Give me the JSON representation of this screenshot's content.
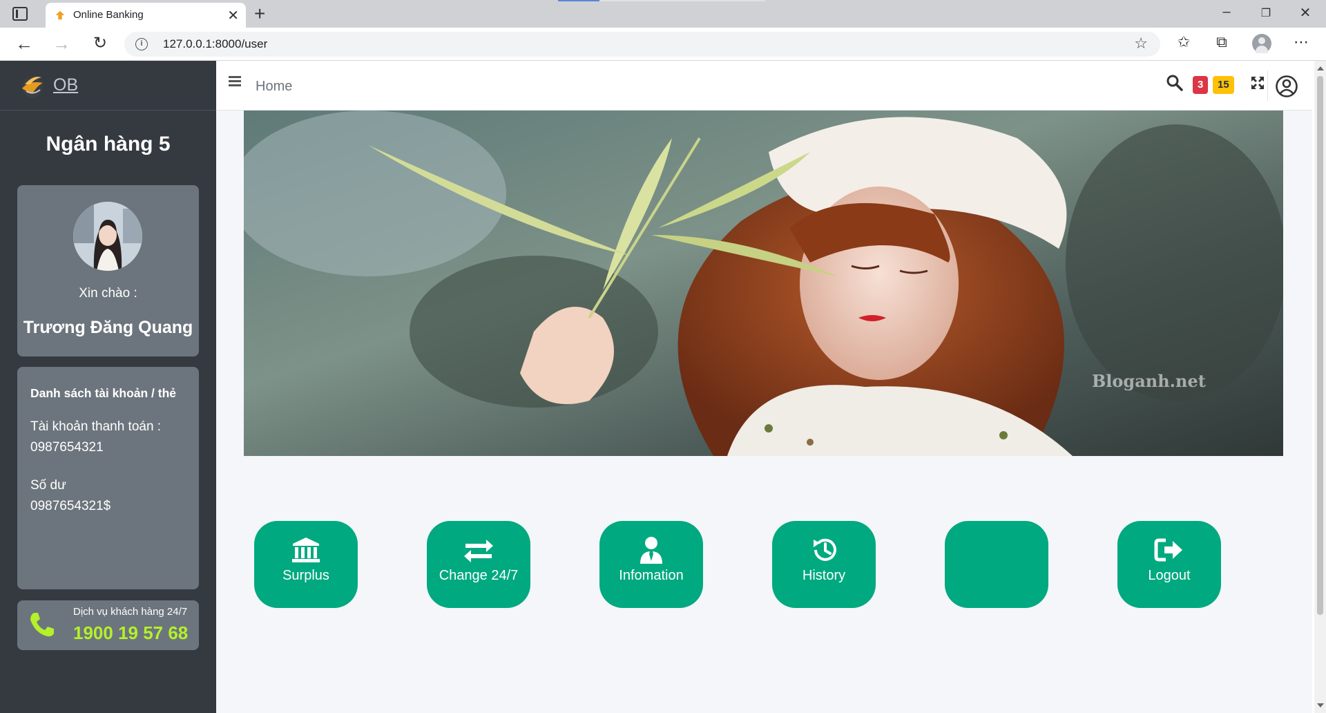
{
  "browser": {
    "tab_title": "Online Banking",
    "url": "127.0.0.1:8000/user"
  },
  "sidebar": {
    "brand": "OB",
    "bank_name": "Ngân hàng 5",
    "greeting": "Xin chào :",
    "user_name": "Trương Đăng Quang",
    "accounts": {
      "title": "Danh sách tài khoản / thẻ",
      "payment_label": "Tài khoản thanh toán :",
      "payment_number": "0987654321",
      "balance_label": "Số dư",
      "balance_value": "0987654321$"
    },
    "support": {
      "label": "Dịch vụ khách hàng 24/7",
      "number": "1900 19 57 68"
    }
  },
  "topnav": {
    "home": "Home",
    "badge_red": "3",
    "badge_yellow": "15"
  },
  "hero": {
    "watermark": "Bloganh.net"
  },
  "actions": [
    {
      "label": "Surplus",
      "icon": "bank-icon"
    },
    {
      "label": "Change 24/7",
      "icon": "exchange-icon"
    },
    {
      "label": "Infomation",
      "icon": "user-tie-icon"
    },
    {
      "label": "History",
      "icon": "history-icon"
    },
    {
      "label": "",
      "icon": ""
    },
    {
      "label": "Logout",
      "icon": "sign-out-icon"
    }
  ],
  "colors": {
    "sidebar": "#343a40",
    "card": "#6c757d",
    "accent": "#00a97f",
    "support_number": "#b5f02a",
    "badge_red": "#dc3545",
    "badge_yellow": "#ffc107"
  }
}
